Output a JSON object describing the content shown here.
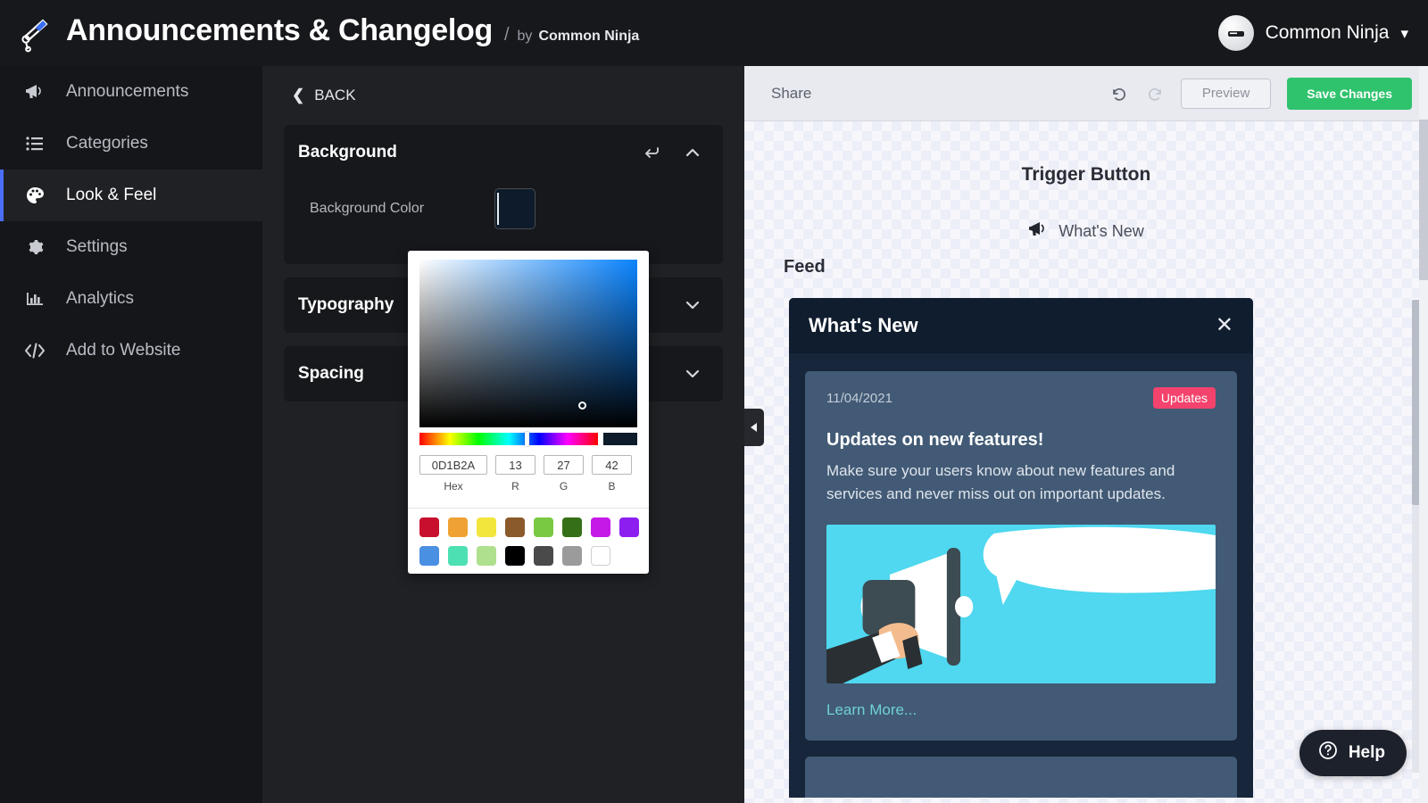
{
  "header": {
    "logo_icon": "megaphone-icon",
    "title": "Announcements & Changelog",
    "separator": "/",
    "by_label": "by",
    "by_name": "Common Ninja",
    "account_name": "Common Ninja",
    "account_caret_icon": "chevron-down-icon",
    "avatar_icon": "ninja-avatar-icon"
  },
  "sidebar": {
    "items": [
      {
        "label": "Announcements",
        "icon": "megaphone-icon",
        "active": false
      },
      {
        "label": "Categories",
        "icon": "list-icon",
        "active": false
      },
      {
        "label": "Look & Feel",
        "icon": "palette-icon",
        "active": true
      },
      {
        "label": "Settings",
        "icon": "gear-icon",
        "active": false
      },
      {
        "label": "Analytics",
        "icon": "bar-chart-icon",
        "active": false
      },
      {
        "label": "Add to Website",
        "icon": "code-icon",
        "active": false
      }
    ]
  },
  "settings": {
    "back_label": "BACK",
    "back_icon": "chevron-left-icon",
    "sections": [
      {
        "title": "Background",
        "expanded": true,
        "reset_icon": "reset-arrow-icon",
        "toggle_icon": "chevron-up-icon",
        "field_label": "Background Color",
        "field_value": "#0D1B2A"
      },
      {
        "title": "Typography",
        "expanded": false,
        "toggle_icon": "chevron-down-icon"
      },
      {
        "title": "Spacing",
        "expanded": false,
        "toggle_icon": "chevron-down-icon"
      }
    ]
  },
  "color_picker": {
    "hex_label": "Hex",
    "hex_value": "0D1B2A",
    "r_label": "R",
    "r_value": "13",
    "g_label": "G",
    "g_value": "27",
    "b_label": "B",
    "b_value": "42",
    "preview_color": "#0D1B2A",
    "swatches_row1": [
      "#C8102E",
      "#EFA233",
      "#F2E63D",
      "#8B5A2B",
      "#7AC943",
      "#357018",
      "#C519E8",
      "#8C1FF0"
    ],
    "swatches_row2": [
      "#4A90E2",
      "#4CE0B3",
      "#AEE08E",
      "#000000",
      "#4A4A4A",
      "#9B9B9B",
      "#FFFFFF"
    ]
  },
  "preview": {
    "share_label": "Share",
    "undo_icon": "undo-icon",
    "redo_icon": "redo-icon",
    "preview_button": "Preview",
    "save_button": "Save Changes",
    "collapse_icon": "chevron-left-icon",
    "trigger_section_title": "Trigger Button",
    "trigger_button_label": "What's New",
    "trigger_button_icon": "megaphone-icon",
    "feed_section_title": "Feed",
    "widget": {
      "title": "What's New",
      "close_icon": "close-icon",
      "cards": [
        {
          "date": "11/04/2021",
          "badge": "Updates",
          "title": "Updates on new features!",
          "text": "Make sure your users know about new features and services and never miss out on important updates.",
          "image_icon": "megaphone-illustration",
          "link": "Learn More..."
        }
      ]
    }
  },
  "help": {
    "label": "Help",
    "icon": "question-circle-icon"
  },
  "colors": {
    "accent_blue": "#4a6ef5",
    "save_green": "#2fc36d",
    "badge_pink": "#f4436c",
    "widget_bg": "#17263a",
    "widget_header": "#101d2e",
    "card_bg": "#425a75",
    "link_teal": "#6fd0d8"
  }
}
